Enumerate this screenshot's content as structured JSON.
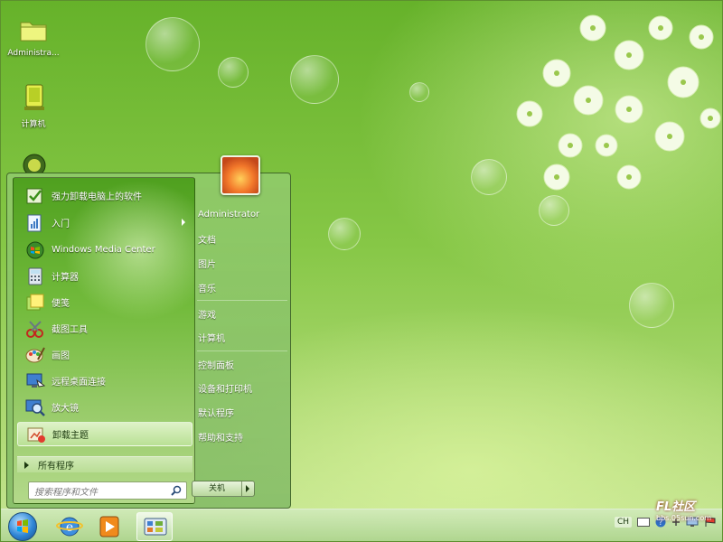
{
  "desktop": {
    "icons": [
      {
        "label": "Administra..."
      },
      {
        "label": "计算机"
      }
    ]
  },
  "start_menu": {
    "programs": [
      {
        "label": "强力卸载电脑上的软件",
        "icon": "uninstall-software-icon"
      },
      {
        "label": "入门",
        "icon": "getting-started-icon",
        "has_submenu": true
      },
      {
        "label": "Windows Media Center",
        "icon": "media-center-icon"
      },
      {
        "label": "计算器",
        "icon": "calculator-icon"
      },
      {
        "label": "便笺",
        "icon": "sticky-notes-icon"
      },
      {
        "label": "截图工具",
        "icon": "snipping-tool-icon"
      },
      {
        "label": "画图",
        "icon": "paint-icon"
      },
      {
        "label": "远程桌面连接",
        "icon": "remote-desktop-icon"
      },
      {
        "label": "放大镜",
        "icon": "magnifier-icon"
      },
      {
        "label": "卸载主题",
        "icon": "uninstall-theme-icon",
        "selected": true
      }
    ],
    "all_programs": "所有程序",
    "search_placeholder": "搜索程序和文件",
    "right_items": [
      {
        "label": "Administrator"
      },
      {
        "label": "文档"
      },
      {
        "label": "图片"
      },
      {
        "label": "音乐"
      },
      {
        "label": "游戏"
      },
      {
        "label": "计算机"
      },
      {
        "label": "控制面板"
      },
      {
        "label": "设备和打印机"
      },
      {
        "label": "默认程序"
      },
      {
        "label": "帮助和支持"
      }
    ],
    "shutdown_label": "关机"
  },
  "taskbar": {
    "pinned": [
      "internet-explorer-icon",
      "media-player-icon",
      "control-panel-icon"
    ],
    "tray_lang": "CH"
  },
  "watermark": {
    "text": "FL社区",
    "url": "bbs.05sun.com"
  },
  "colors": {
    "wallpaper_base": "#7cc23a",
    "menu_text": "#ffffff",
    "selected_text": "#1d3a10"
  }
}
